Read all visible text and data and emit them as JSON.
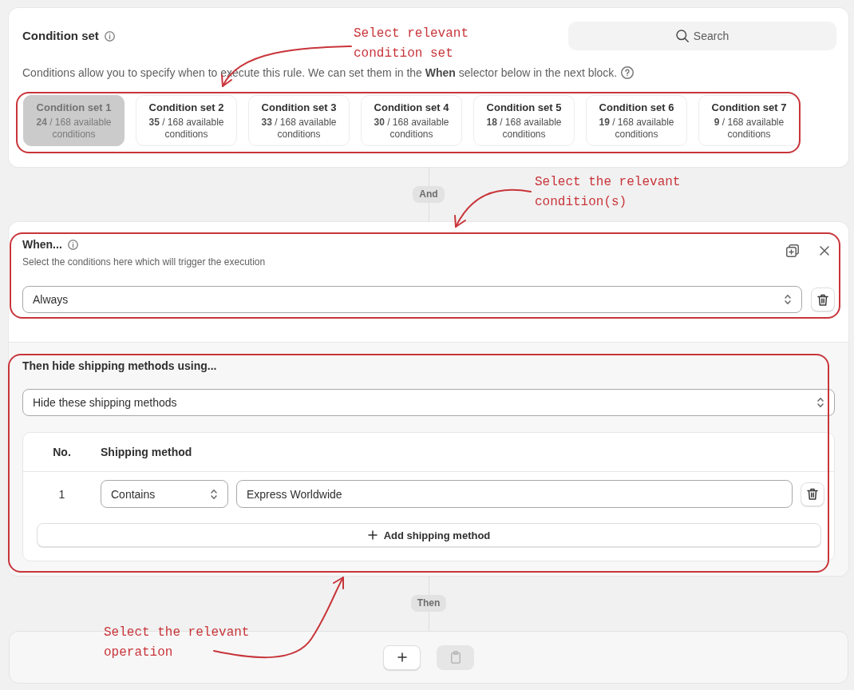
{
  "condition_set": {
    "title": "Condition set",
    "search_button": {
      "label": "Search"
    },
    "description": "Conditions allow you to specify when to execute this rule. We can set them in the **When** selector below in the next block.",
    "sets": [
      {
        "name": "Condition set 1",
        "availability": "**24** / 168 available conditions",
        "selected": true
      },
      {
        "name": "Condition set 2",
        "availability": "**35** / 168 available conditions",
        "selected": false
      },
      {
        "name": "Condition set 3",
        "availability": "**33** / 168 available conditions",
        "selected": false
      },
      {
        "name": "Condition set 4",
        "availability": "**30** / 168 available conditions",
        "selected": false
      },
      {
        "name": "Condition set 5",
        "availability": "**18** / 168 available conditions",
        "selected": false
      },
      {
        "name": "Condition set 6",
        "availability": "**19** / 168 available conditions",
        "selected": false
      },
      {
        "name": "Condition set 7",
        "availability": "**9** / 168 available conditions",
        "selected": false
      }
    ]
  },
  "and_connector": {
    "label": "And"
  },
  "when": {
    "title": "When...",
    "subtitle": "Select the conditions here which will trigger the execution",
    "condition": {
      "value": "Always"
    }
  },
  "then": {
    "title": "Then hide shipping methods using...",
    "mode": {
      "value": "Hide these shipping methods"
    },
    "table": {
      "columns": [
        "No.",
        "Shipping method"
      ],
      "rows": [
        {
          "number": "1",
          "operator": "Contains",
          "method": "Express Worldwide"
        }
      ]
    },
    "add_button": {
      "label": "Add shipping method"
    }
  },
  "then_connector": {
    "label": "Then"
  },
  "actions": [
    {
      "kind": "add",
      "disabled": false
    },
    {
      "kind": "paste",
      "disabled": true
    }
  ],
  "annotations": [
    {
      "text": "Select relevant\ncondition set"
    },
    {
      "text": "Select the relevant\ncondition(s)"
    },
    {
      "text": "Select the relevant\noperation"
    }
  ]
}
